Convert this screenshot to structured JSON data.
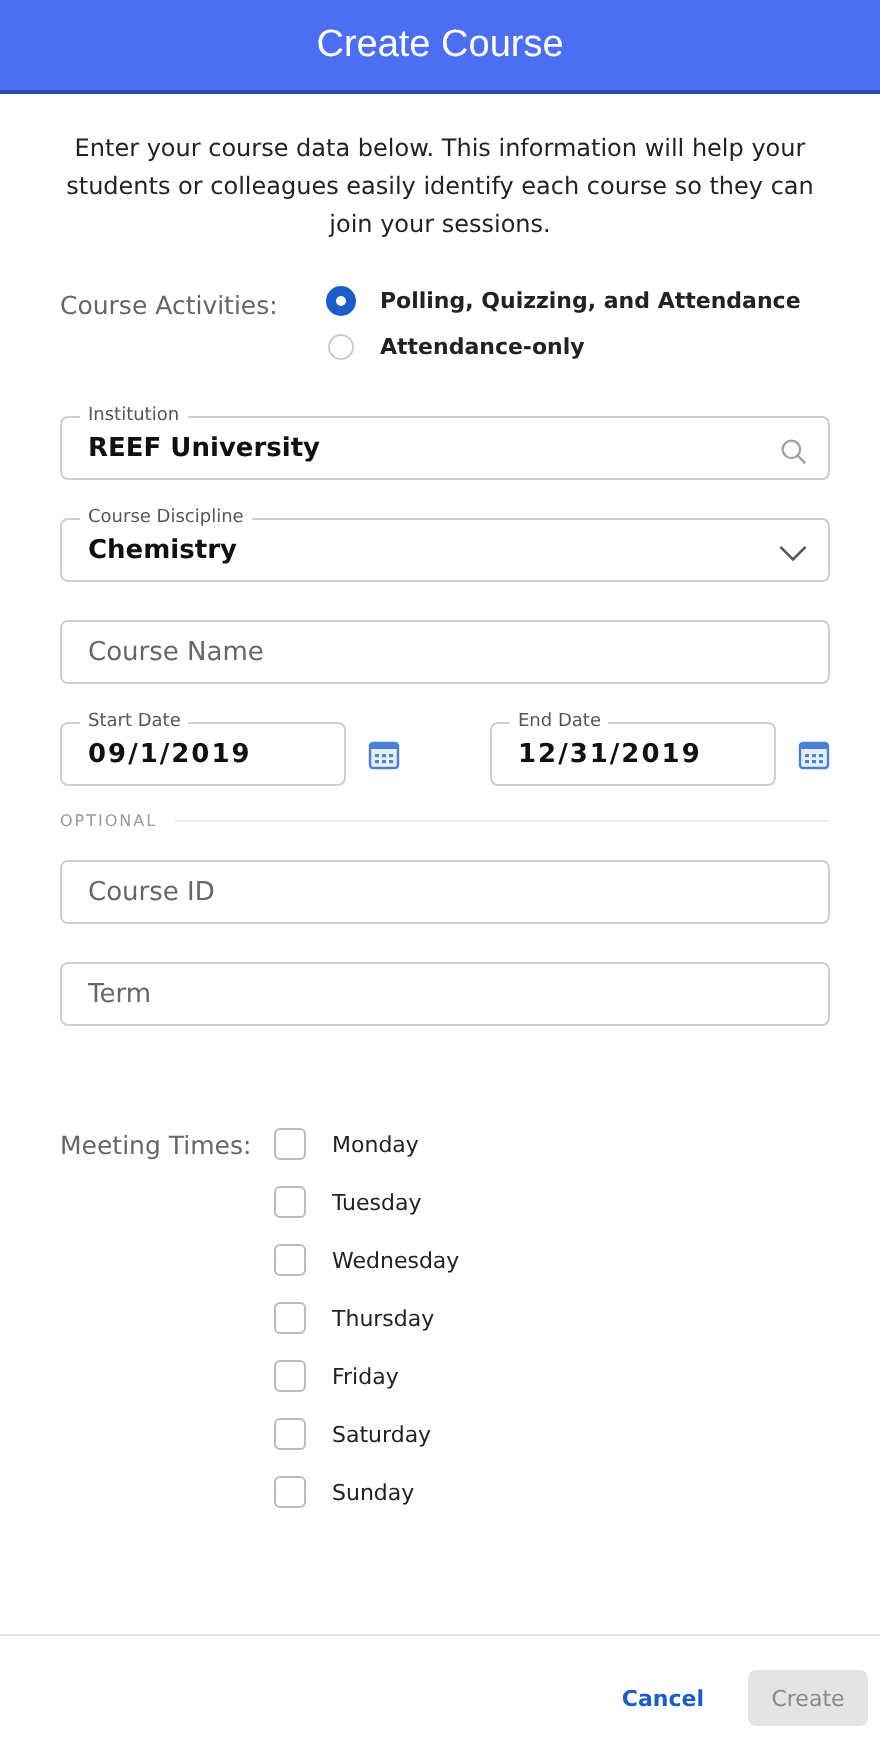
{
  "window": {
    "title": "Create Course"
  },
  "intro": "Enter your course data below. This information will help your students or colleagues easily identify each course so they can join your sessions.",
  "course_activities": {
    "label": "Course Activities:",
    "options": [
      {
        "label": "Polling, Quizzing, and Attendance",
        "selected": true
      },
      {
        "label": "Attendance-only",
        "selected": false
      }
    ]
  },
  "institution": {
    "label": "Institution",
    "value": "REEF University"
  },
  "course_discipline": {
    "label": "Course Discipline",
    "value": "Chemistry"
  },
  "course_name": {
    "placeholder": "Course Name"
  },
  "start_date": {
    "label": "Start Date",
    "value": "09/1/2019"
  },
  "end_date": {
    "label": "End Date",
    "value": "12/31/2019"
  },
  "optional_heading": "OPTIONAL",
  "course_id": {
    "placeholder": "Course ID"
  },
  "term": {
    "placeholder": "Term"
  },
  "meeting_times": {
    "label": "Meeting Times:",
    "days": [
      {
        "label": "Monday",
        "checked": false
      },
      {
        "label": "Tuesday",
        "checked": false
      },
      {
        "label": "Wednesday",
        "checked": false
      },
      {
        "label": "Thursday",
        "checked": false
      },
      {
        "label": "Friday",
        "checked": false
      },
      {
        "label": "Saturday",
        "checked": false
      },
      {
        "label": "Sunday",
        "checked": false
      }
    ]
  },
  "buttons": {
    "cancel": {
      "label": "Cancel"
    },
    "create": {
      "label": "Create",
      "disabled": true
    }
  }
}
